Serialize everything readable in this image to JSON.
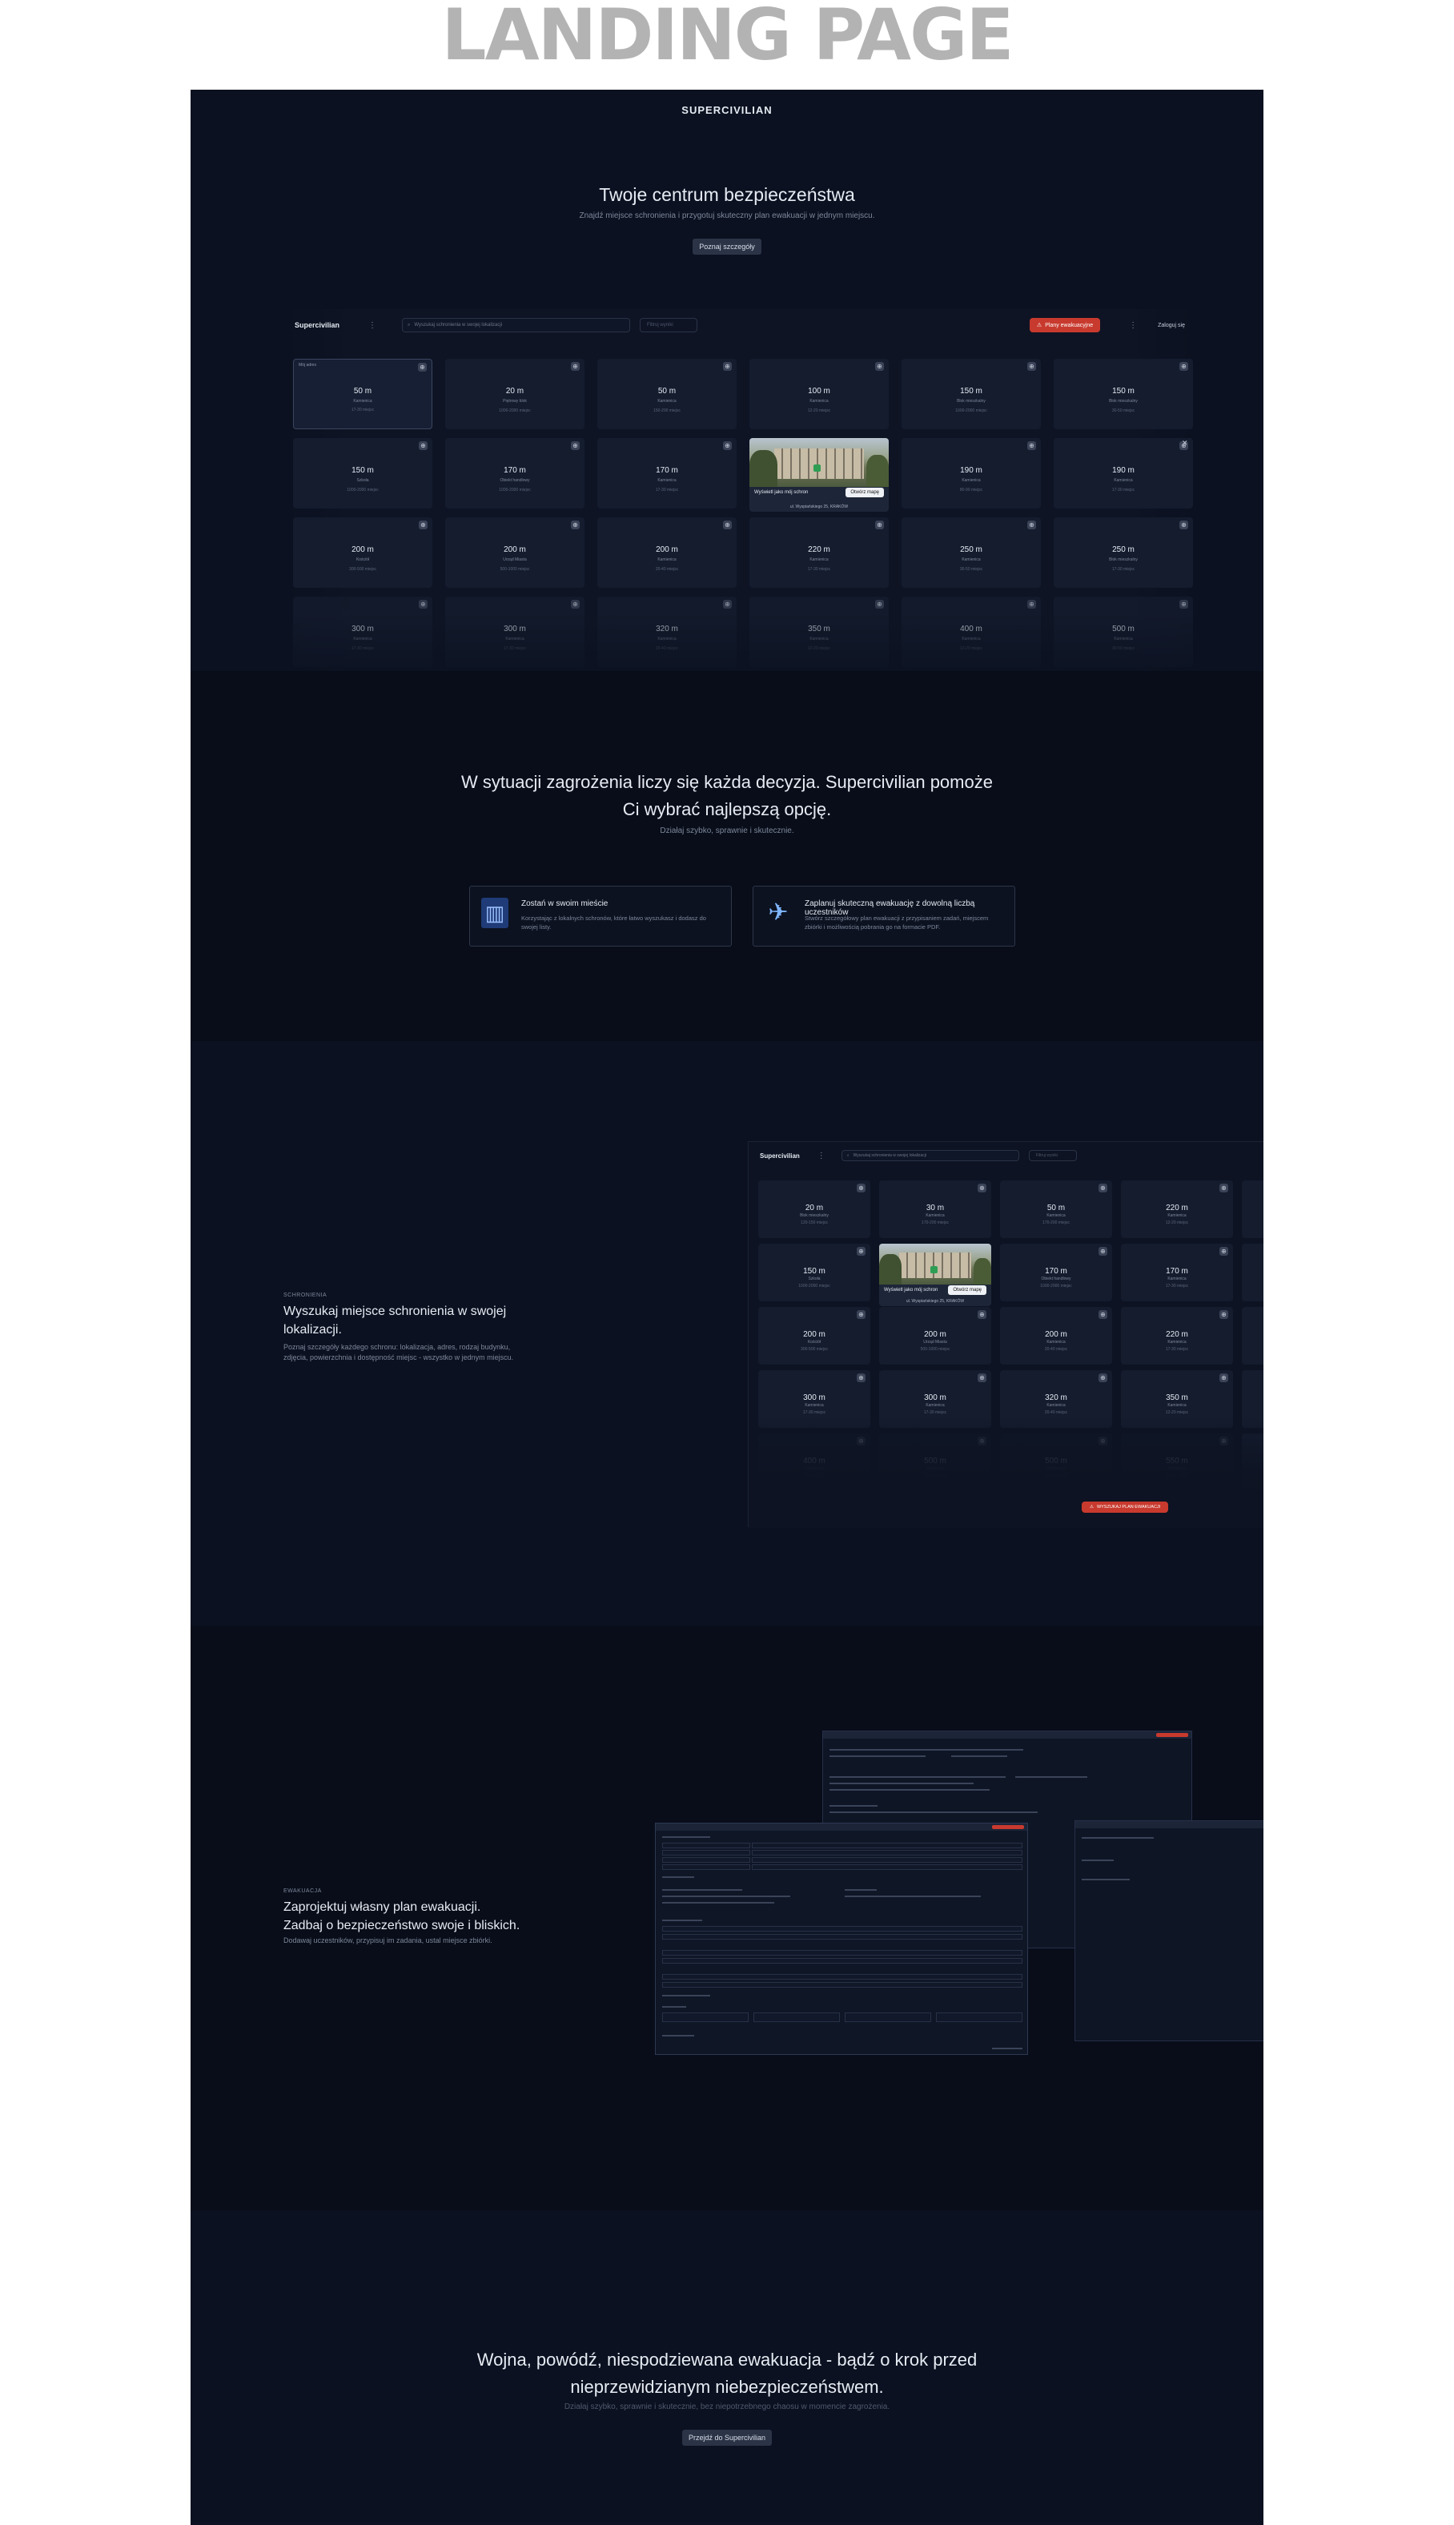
{
  "page_heading": "LANDING PAGE",
  "header": {
    "brand": "SUPERCIVILIAN"
  },
  "hero": {
    "title": "Twoje centrum bezpieczeństwa",
    "subtitle": "Znajdź miejsce schronienia i przygotuj skuteczny plan ewakuacji w jednym miejscu.",
    "button": "Poznaj szczegóły"
  },
  "app_preview": {
    "logo": "Supercivilian",
    "search_placeholder": "Wyszukaj schronienia w swojej lokalizacji",
    "filter_placeholder": "Filtruj wyniki",
    "plan_button": "Plany ewakuacyjne",
    "login": "Zaloguj się",
    "selected_label": "Mój adres",
    "cards": [
      {
        "dist": "50 m",
        "type": "Kamienica",
        "cap": "17-30 miejsc"
      },
      {
        "dist": "20 m",
        "type": "Piętrowy blok",
        "cap": "1000-2000 miejsc"
      },
      {
        "dist": "50 m",
        "type": "Kamienica",
        "cap": "150-200 miejsc"
      },
      {
        "dist": "100 m",
        "type": "Kamienica",
        "cap": "12-20 miejsc"
      },
      {
        "dist": "150 m",
        "type": "Blok mieszkalny",
        "cap": "1000-2000 miejsc"
      },
      {
        "dist": "150 m",
        "type": "Blok mieszkalny",
        "cap": "30-50 miejsc"
      },
      {
        "dist": "150 m",
        "type": "Szkoła",
        "cap": "1000-2000 miejsc"
      },
      {
        "dist": "170 m",
        "type": "Obiekt handlowy",
        "cap": "1000-2000 miejsc"
      },
      {
        "dist": "170 m",
        "type": "Kamienica",
        "cap": "17-30 miejsc"
      },
      {
        "dist": "",
        "type": "",
        "cap": ""
      },
      {
        "dist": "190 m",
        "type": "Kamienica",
        "cap": "80-90 miejsc"
      },
      {
        "dist": "190 m",
        "type": "Kamienica",
        "cap": "17-30 miejsc"
      },
      {
        "dist": "200 m",
        "type": "Kościół",
        "cap": "300-500 miejsc"
      },
      {
        "dist": "200 m",
        "type": "Urząd Miasta",
        "cap": "500-1000 miejsc"
      },
      {
        "dist": "200 m",
        "type": "Kamienica",
        "cap": "20-40 miejsc"
      },
      {
        "dist": "220 m",
        "type": "Kamienica",
        "cap": "17-30 miejsc"
      },
      {
        "dist": "250 m",
        "type": "Kamienica",
        "cap": "30-50 miejsc"
      },
      {
        "dist": "250 m",
        "type": "Blok mieszkalny",
        "cap": "17-30 miejsc"
      },
      {
        "dist": "300 m",
        "type": "Kamienica",
        "cap": "17-30 miejsc"
      },
      {
        "dist": "300 m",
        "type": "Kamienica",
        "cap": "17-30 miejsc"
      },
      {
        "dist": "320 m",
        "type": "Kamienica",
        "cap": "20-40 miejsc"
      },
      {
        "dist": "350 m",
        "type": "Kamienica",
        "cap": "12-20 miejsc"
      },
      {
        "dist": "400 m",
        "type": "Kamienica",
        "cap": "12-20 miejsc"
      },
      {
        "dist": "500 m",
        "type": "Kamienica",
        "cap": "30-50 miejsc"
      }
    ],
    "photo_card": {
      "label": "Wyświetl jako mój schron",
      "button": "Otwórz mapę",
      "address": "ul. Wyspiańskiego 25, KRAKÓW"
    }
  },
  "mission": {
    "title_line1": "W sytuacji zagrożenia liczy się każda decyzja. Supercivilian pomoże",
    "title_line2": "Ci wybrać najlepszą opcję.",
    "subtitle": "Działaj szybko, sprawnie i skutecznie.",
    "features": [
      {
        "title": "Zostań w swoim mieście",
        "desc": "Korzystając z lokalnych schronów, które łatwo wyszukasz i dodasz do swojej listy.",
        "icon": "city-buildings-icon"
      },
      {
        "title": "Zaplanuj skuteczną ewakuację z dowolną liczbą uczestników",
        "desc": "Stwórz szczegółowy plan ewakuacji z przypisaniem zadań, miejscem zbiórki i możliwością pobrania go na formacie PDF.",
        "icon": "airplane-icon"
      }
    ]
  },
  "shelter_feature": {
    "eyebrow": "SCHRONIENIA",
    "title_line1": "Wyszukaj miejsce schronienia w swojej",
    "title_line2": "lokalizacji.",
    "desc_line1": "Poznaj szczegóły każdego schronu: lokalizacja, adres, rodzaj budynku,",
    "desc_line2": "zdjęcia, powierzchnia i dostępność miejsc - wszystko w jednym miejscu.",
    "preview_logo": "Supercivilian",
    "preview_search": "Wyszukaj schronienia w swojej lokalizacji",
    "preview_filter": "Filtruj wyniki",
    "preview_button": "WYSZUKAJ PLAN EWAKUACJI",
    "cards": [
      {
        "dist": "20 m",
        "type": "Blok mieszkalny",
        "cap": "120-150 miejsc"
      },
      {
        "dist": "30 m",
        "type": "Kamienica",
        "cap": "170-200 miejsc"
      },
      {
        "dist": "50 m",
        "type": "Kamienica",
        "cap": "170-200 miejsc"
      },
      {
        "dist": "220 m",
        "type": "Kamienica",
        "cap": "12-20 miejsc"
      },
      {
        "dist": "150 m",
        "type": "Szkoła",
        "cap": "1000-2000 miejsc"
      },
      {
        "dist": "",
        "type": "",
        "cap": ""
      },
      {
        "dist": "170 m",
        "type": "Obiekt handlowy",
        "cap": "1000-2000 miejsc"
      },
      {
        "dist": "170 m",
        "type": "Kamienica",
        "cap": "17-30 miejsc"
      },
      {
        "dist": "200 m",
        "type": "Kościół",
        "cap": "300-500 miejsc"
      },
      {
        "dist": "200 m",
        "type": "Urząd Miasta",
        "cap": "500-1000 miejsc"
      },
      {
        "dist": "200 m",
        "type": "Kamienica",
        "cap": "20-40 miejsc"
      },
      {
        "dist": "220 m",
        "type": "Kamienica",
        "cap": "17-30 miejsc"
      },
      {
        "dist": "300 m",
        "type": "Kamienica",
        "cap": "17-30 miejsc"
      },
      {
        "dist": "300 m",
        "type": "Kamienica",
        "cap": "17-30 miejsc"
      },
      {
        "dist": "320 m",
        "type": "Kamienica",
        "cap": "20-40 miejsc"
      },
      {
        "dist": "350 m",
        "type": "Kamienica",
        "cap": "12-20 miejsc"
      },
      {
        "dist": "400 m",
        "type": "Kamienica",
        "cap": "12-20 miejsc"
      },
      {
        "dist": "500 m",
        "type": "Kamienica",
        "cap": "30-50 miejsc"
      },
      {
        "dist": "500 m",
        "type": "Kamienica",
        "cap": "30-50 miejsc"
      },
      {
        "dist": "550 m",
        "type": "Kamienica",
        "cap": "30-50 miejsc"
      }
    ],
    "photo_card": {
      "label": "Wyświetl jako mój schron",
      "button": "Otwórz mapę",
      "address": "ul. Wyspiańskiego 25, KRAKÓW"
    }
  },
  "evac_feature": {
    "eyebrow": "EWAKUACJA",
    "title_line1": "Zaprojektuj własny plan ewakuacji.",
    "title_line2": "Zadbaj o bezpieczeństwo swoje i bliskich.",
    "desc": "Dodawaj uczestników, przypisuj im zadania, ustal miejsce zbiórki."
  },
  "cta": {
    "title_line1": "Wojna, powódź, niespodziewana ewakuacja - bądź o krok przed",
    "title_line2": "nieprzewidzianym niebezpieczeństwem.",
    "subtitle": "Działaj szybko, sprawnie i skutecznie, bez niepotrzebnego chaosu w momencie zagrożenia.",
    "button": "Przejdź do Supercivilian"
  },
  "colors": {
    "background": "#0b1120",
    "accent_red": "#c83a2e",
    "card": "#141c2e"
  }
}
